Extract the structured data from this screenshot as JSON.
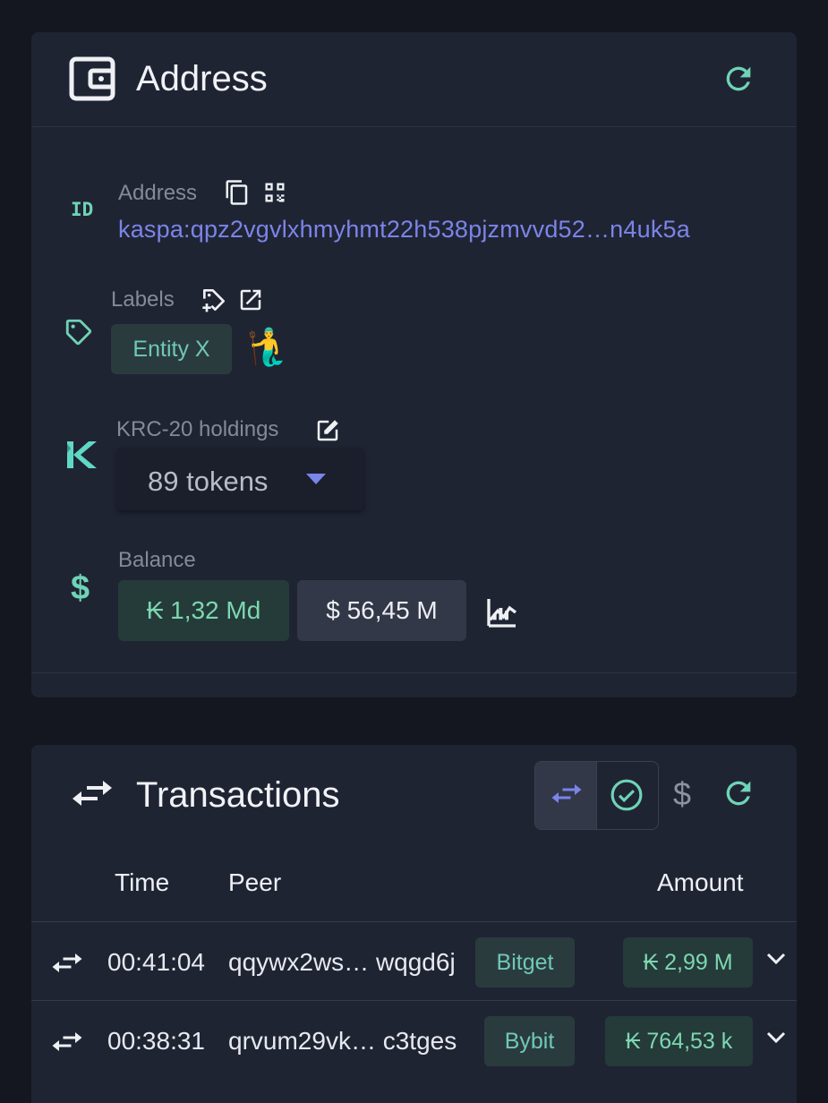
{
  "address_card": {
    "title": "Address",
    "address_label": "Address",
    "address_value": "kaspa:qpz2vgvlxhmyhmt22h538pjzmvvd52…n4uk5a",
    "id_badge": "ID",
    "labels_label": "Labels",
    "label_chip": "Entity X",
    "label_emoji": "🧜‍♂️",
    "krc20_label": "KRC-20 holdings",
    "tokens_value": "89 tokens",
    "balance_label": "Balance",
    "balance_kas": "₭ 1,32 Md",
    "balance_usd": "$ 56,45 M"
  },
  "transactions_card": {
    "title": "Transactions",
    "dollar_toggle": "$",
    "columns": {
      "time": "Time",
      "peer": "Peer",
      "amount": "Amount"
    },
    "rows": [
      {
        "time": "00:41:04",
        "peer": "qqywx2ws… wqgd6j",
        "tag": "Bitget",
        "amount": "₭ 2,99 M"
      },
      {
        "time": "00:38:31",
        "peer": "qrvum29vk… c3tges",
        "tag": "Bybit",
        "amount": "₭ 764,53 k"
      }
    ]
  },
  "colors": {
    "background": "#14171f",
    "card": "#1f2433",
    "accent_teal": "#6fd3b6",
    "link_blue": "#7b84e8",
    "chip_green_bg": "#243b3a",
    "chip_gray_bg": "#333848"
  },
  "icons": [
    "wallet-icon",
    "refresh-icon",
    "copy-icon",
    "qr-code-icon",
    "tag-icon",
    "add-tag-icon",
    "external-link-icon",
    "kasplex-logo-icon",
    "edit-icon",
    "dollar-icon",
    "caret-down-icon",
    "chart-icon",
    "transfer-icon",
    "check-circle-icon",
    "chevron-down-icon"
  ]
}
